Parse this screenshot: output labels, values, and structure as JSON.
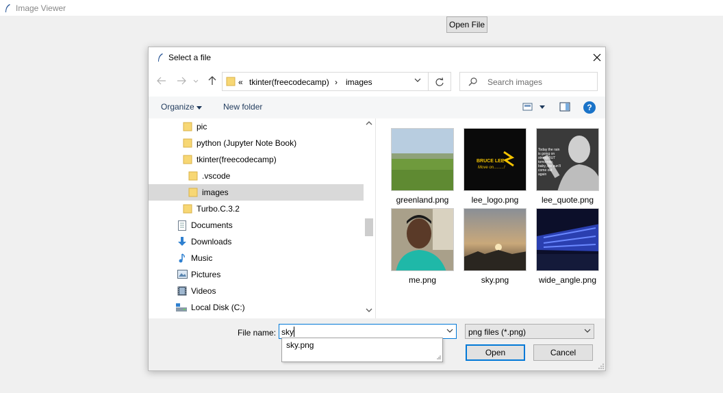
{
  "app": {
    "title": "Image Viewer",
    "open_button": "Open File"
  },
  "dialog": {
    "title": "Select a file",
    "address": {
      "prefix": "«",
      "crumb1": "tkinter(freecodecamp)",
      "separator": "›",
      "crumb2": "images"
    },
    "search_placeholder": "Search images",
    "toolbar": {
      "organize": "Organize",
      "new_folder": "New folder",
      "help": "?"
    },
    "tree": [
      {
        "label": "pic",
        "icon": "folder-icon"
      },
      {
        "label": "python (Jupyter Note Book)",
        "icon": "folder-icon"
      },
      {
        "label": "tkinter(freecodecamp)",
        "icon": "folder-icon"
      },
      {
        "label": ".vscode",
        "icon": "folder-icon"
      },
      {
        "label": "images",
        "icon": "folder-icon",
        "selected": true
      },
      {
        "label": "Turbo.C.3.2",
        "icon": "folder-icon"
      },
      {
        "label": "Documents",
        "icon": "documents-icon"
      },
      {
        "label": "Downloads",
        "icon": "downloads-icon"
      },
      {
        "label": "Music",
        "icon": "music-icon"
      },
      {
        "label": "Pictures",
        "icon": "pictures-icon"
      },
      {
        "label": "Videos",
        "icon": "videos-icon"
      },
      {
        "label": "Local Disk (C:)",
        "icon": "local-disk-icon"
      }
    ],
    "files": [
      {
        "name": "greenland.png"
      },
      {
        "name": "lee_logo.png",
        "thumb_text": "BRUCE LEE",
        "thumb_subtext": "Move on.........!"
      },
      {
        "name": "lee_quote.png",
        "thumb_text": "Today the rain is going on strong BUT tomorrow, baby, the sun'll come out again"
      },
      {
        "name": "me.png"
      },
      {
        "name": "sky.png"
      },
      {
        "name": "wide_angle.png"
      }
    ],
    "file_name": {
      "label": "File name:",
      "value": "sky",
      "suggestion": "sky.png"
    },
    "file_type": "png files (*.png)",
    "buttons": {
      "open": "Open",
      "cancel": "Cancel"
    }
  },
  "colors": {
    "accent": "#0078d7",
    "folder": "#f7d774",
    "help": "#1a73c8",
    "selection": "#d9d9d9"
  }
}
